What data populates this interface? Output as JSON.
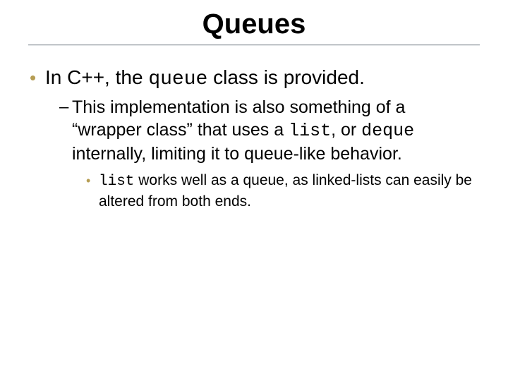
{
  "title": "Queues",
  "lvl1": {
    "pre": "In C++, the ",
    "code": "queue",
    "post": " class is provided."
  },
  "lvl2": {
    "a": "This implementation is also something of a “wrapper class” that uses a ",
    "code1": "list",
    "b": ", or ",
    "code2": "deque",
    "c": " internally, limiting it to queue-like behavior."
  },
  "lvl3": {
    "code": "list",
    "rest": " works well as a queue, as linked-lists can easily be altered from both ends."
  }
}
